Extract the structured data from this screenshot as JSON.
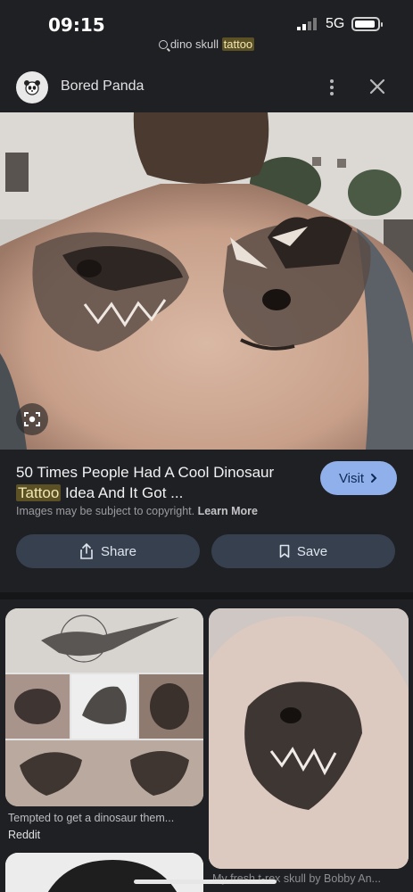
{
  "status": {
    "time": "09:15",
    "network": "5G"
  },
  "query": {
    "prefix": "dino skull ",
    "highlight": "tattoo"
  },
  "source": {
    "name": "Bored Panda"
  },
  "result": {
    "title_line1": "50 Times People Had A Cool Dinosaur",
    "title_hl": "Tattoo",
    "title_line2_rest": " Idea And It Got ...",
    "visit_label": "Visit",
    "copyright_text": "Images may be subject to copyright.",
    "learn_more": "Learn More",
    "share_label": "Share",
    "save_label": "Save"
  },
  "related": [
    {
      "caption": "Tempted to get a dinosaur them...",
      "source": "Reddit"
    },
    {
      "caption": "My fresh t-rex skull by Bobby An..."
    }
  ],
  "colors": {
    "accent": "#8fb0ea",
    "highlight": "#5b5125",
    "pill": "#36404f"
  }
}
